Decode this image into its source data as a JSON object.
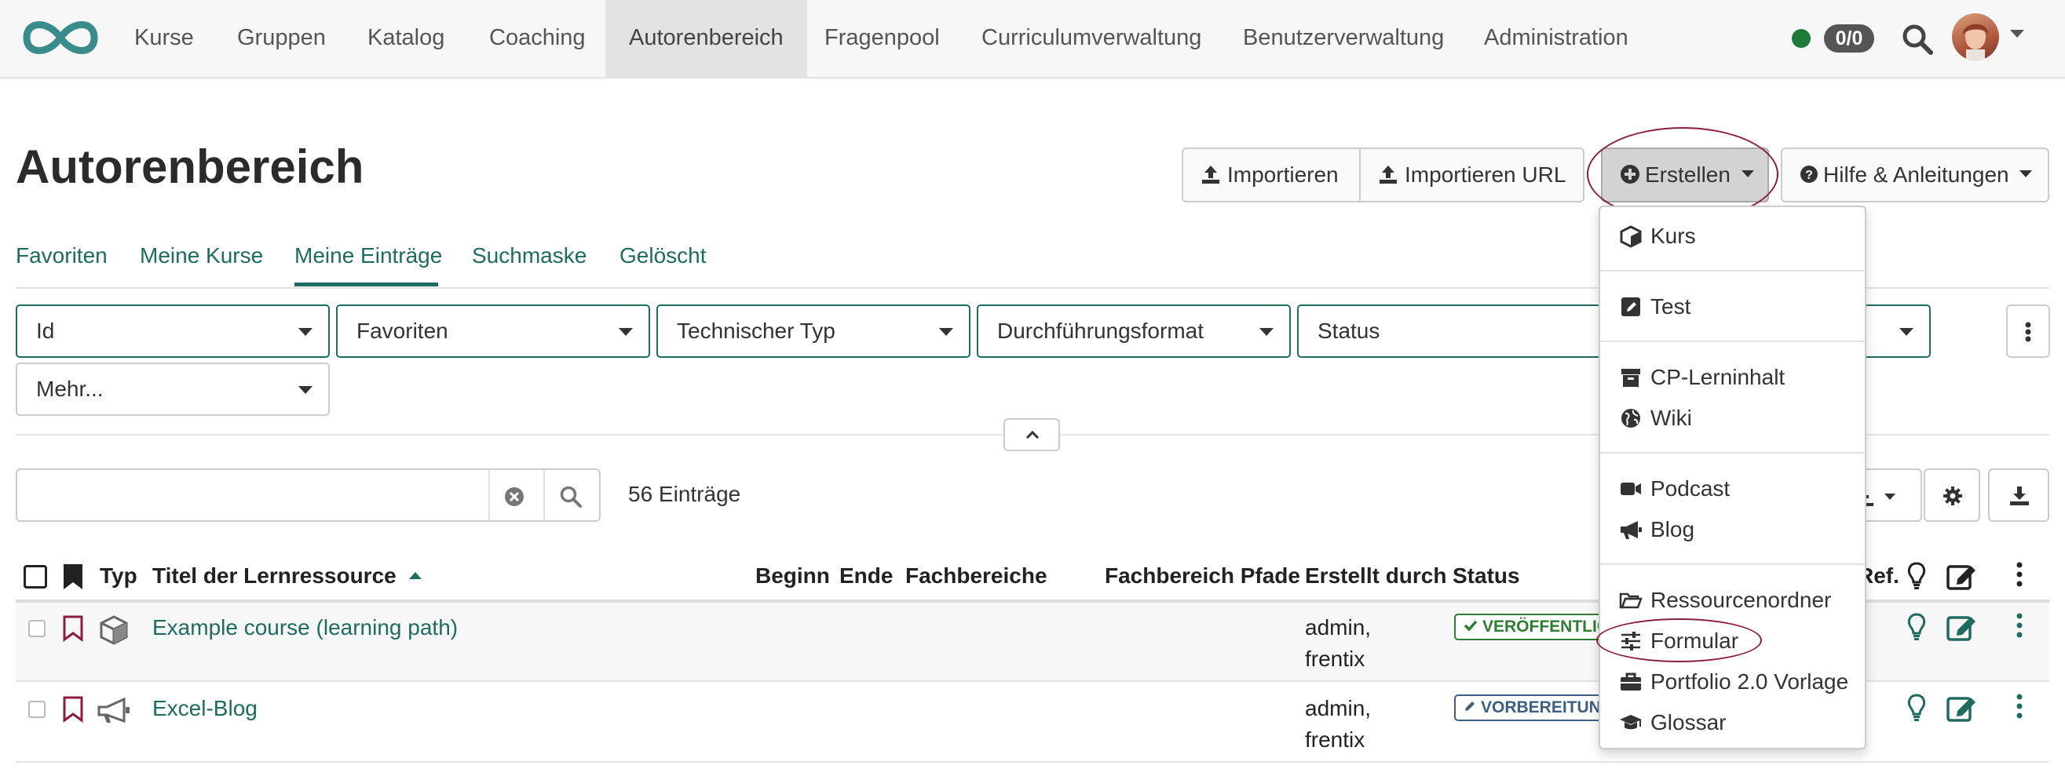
{
  "nav": {
    "items": [
      "Kurse",
      "Gruppen",
      "Katalog",
      "Coaching",
      "Autorenbereich",
      "Fragenpool",
      "Curriculumverwaltung",
      "Benutzerverwaltung",
      "Administration"
    ],
    "active": "Autorenbereich",
    "count_badge": "0/0",
    "status_color": "#1f7a3a"
  },
  "header": {
    "title": "Autorenbereich",
    "import_label": "Importieren",
    "import_url_label": "Importieren URL",
    "create_label": "Erstellen",
    "help_label": "Hilfe & Anleitungen"
  },
  "tabs": [
    "Favoriten",
    "Meine Kurse",
    "Meine Einträge",
    "Suchmaske",
    "Gelöscht"
  ],
  "active_tab": "Meine Einträge",
  "filters": [
    "Id",
    "Favoriten",
    "Technischer Typ",
    "Durchführungsformat",
    "Status",
    "Mehr..."
  ],
  "search": {
    "value": "",
    "entries": "56 Einträge"
  },
  "table": {
    "headers": [
      "Typ",
      "Titel der Lernressource",
      "Beginn",
      "Ende",
      "Fachbereiche",
      "Fachbereich Pfade",
      "Erstellt durch",
      "Status",
      "Ref."
    ],
    "rows": [
      {
        "title": "Example course (learning path)",
        "created_by_1": "admin,",
        "created_by_2": "frentix",
        "status": "VERÖFFENTLICHT",
        "type_icon": "cube-icon"
      },
      {
        "title": "Excel-Blog",
        "created_by_1": "admin,",
        "created_by_2": "frentix",
        "status": "VORBEREITUNG",
        "type_icon": "megaphone-icon"
      }
    ]
  },
  "dropdown": {
    "items": [
      "Kurs",
      "Test",
      "CP-Lerninhalt",
      "Wiki",
      "Podcast",
      "Blog",
      "Ressourcenordner",
      "Formular",
      "Portfolio 2.0 Vorlage",
      "Glossar"
    ]
  },
  "colors": {
    "accent": "#1f6b5f",
    "highlight": "#8b1d40",
    "bookmark": "#8b1d40"
  }
}
